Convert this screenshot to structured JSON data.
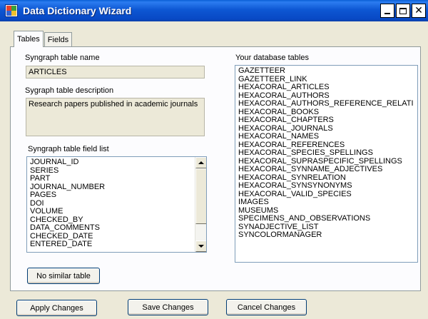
{
  "window": {
    "title": "Data Dictionary Wizard",
    "controls": {
      "minimize": "_",
      "maximize": "□",
      "close": "×"
    }
  },
  "tabs": [
    {
      "label": "Tables",
      "active": true
    },
    {
      "label": "Fields",
      "active": false
    }
  ],
  "table_name": {
    "label": "Syngraph table name",
    "value": "ARTICLES"
  },
  "table_description": {
    "label": "Sygraph table description",
    "value": "Research papers published in academic journals"
  },
  "field_list": {
    "label": "Syngraph table field list",
    "items": [
      "JOURNAL_ID",
      "SERIES",
      "PART",
      "JOURNAL_NUMBER",
      "PAGES",
      "DOI",
      "VOLUME",
      "CHECKED_BY",
      "DATA_COMMENTS",
      "CHECKED_DATE",
      "ENTERED_DATE"
    ]
  },
  "database_tables": {
    "label": "Your database tables",
    "items": [
      "GAZETTEER",
      "GAZETTEER_LINK",
      "HEXACORAL_ARTICLES",
      "HEXACORAL_AUTHORS",
      "HEXACORAL_AUTHORS_REFERENCE_RELATI",
      "HEXACORAL_BOOKS",
      "HEXACORAL_CHAPTERS",
      "HEXACORAL_JOURNALS",
      "HEXACORAL_NAMES",
      "HEXACORAL_REFERENCES",
      "HEXACORAL_SPECIES_SPELLINGS",
      "HEXACORAL_SUPRASPECIFIC_SPELLINGS",
      "HEXACORAL_SYNNAME_ADJECTIVES",
      "HEXACORAL_SYNRELATION",
      "HEXACORAL_SYNSYNONYMS",
      "HEXACORAL_VALID_SPECIES",
      "IMAGES",
      "MUSEUMS",
      "SPECIMENS_AND_OBSERVATIONS",
      "SYNADJECTIVE_LIST",
      "SYNCOLORMANAGER"
    ]
  },
  "buttons": {
    "no_similar": "No similar table",
    "apply": "Apply Changes",
    "save": "Save Changes",
    "cancel": "Cancel Changes"
  },
  "colors": {
    "titlebar": "#0a5fd6",
    "dialog_bg": "#ece9d8",
    "listbox_border": "#7f9db9"
  }
}
